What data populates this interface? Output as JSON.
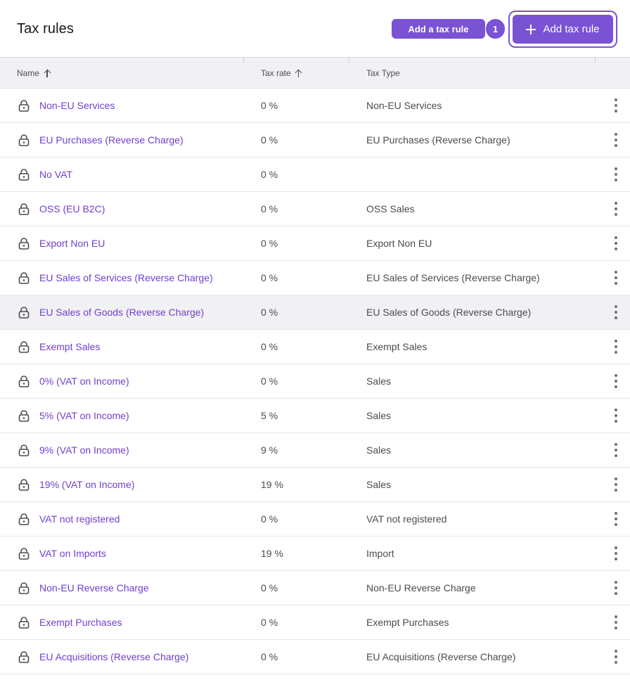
{
  "header": {
    "title": "Tax rules",
    "tooltip_label": "Add a tax rule",
    "badge_count": "1",
    "add_button_label": "Add tax rule"
  },
  "table": {
    "columns": [
      "Name",
      "Tax rate",
      "Tax Type"
    ],
    "rows": [
      {
        "name": "Non-EU Services",
        "rate": "0 %",
        "type": "Non-EU Services"
      },
      {
        "name": "EU Purchases (Reverse Charge)",
        "rate": "0 %",
        "type": "EU Purchases (Reverse Charge)"
      },
      {
        "name": "No VAT",
        "rate": "0 %",
        "type": ""
      },
      {
        "name": "OSS (EU B2C)",
        "rate": "0 %",
        "type": "OSS Sales"
      },
      {
        "name": "Export Non EU",
        "rate": "0 %",
        "type": "Export Non EU"
      },
      {
        "name": "EU Sales of Services (Reverse Charge)",
        "rate": "0 %",
        "type": "EU Sales of Services (Reverse Charge)"
      },
      {
        "name": "EU Sales of Goods (Reverse Charge)",
        "rate": "0 %",
        "type": "EU Sales of Goods (Reverse Charge)"
      },
      {
        "name": "Exempt Sales",
        "rate": "0 %",
        "type": "Exempt Sales"
      },
      {
        "name": "0% (VAT on Income)",
        "rate": "0 %",
        "type": "Sales"
      },
      {
        "name": "5% (VAT on Income)",
        "rate": "5 %",
        "type": "Sales"
      },
      {
        "name": "9% (VAT on Income)",
        "rate": "9 %",
        "type": "Sales"
      },
      {
        "name": "19% (VAT on Income)",
        "rate": "19 %",
        "type": "Sales"
      },
      {
        "name": "VAT not registered",
        "rate": "0 %",
        "type": "VAT not registered"
      },
      {
        "name": "VAT on Imports",
        "rate": "19 %",
        "type": "Import"
      },
      {
        "name": "Non-EU Reverse Charge",
        "rate": "0 %",
        "type": "Non-EU Reverse Charge"
      },
      {
        "name": "Exempt Purchases",
        "rate": "0 %",
        "type": "Exempt Purchases"
      },
      {
        "name": "EU Acquisitions (Reverse Charge)",
        "rate": "0 %",
        "type": "EU Acquisitions (Reverse Charge)"
      }
    ]
  },
  "icons": {
    "row_icon": "lock-icon",
    "row_menu": "kebab-menu-icon",
    "sort": "arrow-up-icon",
    "add": "plus-icon"
  },
  "colors": {
    "accent": "#7a52d4",
    "link": "#6f3fd0",
    "header_bg": "#f1f1f3"
  }
}
